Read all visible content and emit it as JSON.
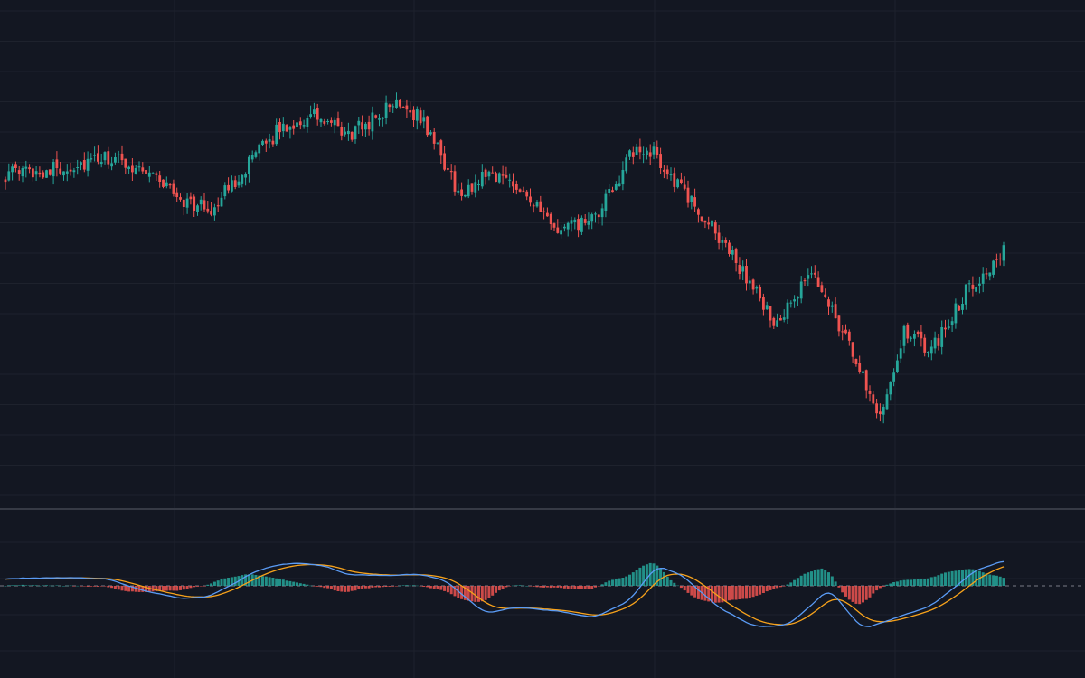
{
  "colors": {
    "background": "#131722",
    "grid": "#1e222d",
    "separator": "#363a45",
    "up": "#26a69a",
    "down": "#ef5350",
    "macd_line": "#5b9cf6",
    "signal_line": "#f7a21b",
    "zero_line": "#787b86"
  },
  "chart_data": [
    {
      "type": "candlestick",
      "panel": "price",
      "grid": true,
      "x": {
        "count": 292
      },
      "y": {
        "range": [
          0,
          100
        ]
      },
      "trend_anchors": [
        [
          0,
          80
        ],
        [
          18,
          82
        ],
        [
          30,
          84.5
        ],
        [
          42,
          81
        ],
        [
          52,
          72.5
        ],
        [
          60,
          70
        ],
        [
          70,
          82
        ],
        [
          80,
          93
        ],
        [
          90,
          96.5
        ],
        [
          100,
          91
        ],
        [
          115,
          101
        ],
        [
          122,
          95
        ],
        [
          133,
          73
        ],
        [
          140,
          81
        ],
        [
          150,
          77
        ],
        [
          160,
          64
        ],
        [
          172,
          67
        ],
        [
          182,
          85
        ],
        [
          188,
          87
        ],
        [
          200,
          72
        ],
        [
          210,
          60
        ],
        [
          225,
          37
        ],
        [
          235,
          52
        ],
        [
          240,
          44
        ],
        [
          255,
          12
        ],
        [
          262,
          35
        ],
        [
          270,
          30
        ],
        [
          280,
          47
        ],
        [
          291,
          58
        ]
      ],
      "wick_extremes": {
        "max_high": 103.5,
        "min_low": 0
      }
    },
    {
      "type": "macd",
      "panel": "indicator",
      "grid": true,
      "x": {
        "count": 292
      },
      "y": {
        "range": [
          -100,
          40
        ]
      },
      "zero_line": true,
      "series": [
        {
          "key": "macd",
          "kind": "line"
        },
        {
          "key": "signal",
          "kind": "line"
        },
        {
          "key": "histogram",
          "kind": "bar"
        }
      ],
      "macd_anchors": [
        [
          0,
          10
        ],
        [
          15,
          11
        ],
        [
          30,
          9
        ],
        [
          40,
          -6
        ],
        [
          52,
          -18
        ],
        [
          60,
          -14
        ],
        [
          72,
          18
        ],
        [
          82,
          32
        ],
        [
          92,
          28
        ],
        [
          100,
          16
        ],
        [
          108,
          14
        ],
        [
          120,
          16
        ],
        [
          128,
          8
        ],
        [
          140,
          -38
        ],
        [
          150,
          -30
        ],
        [
          160,
          -34
        ],
        [
          172,
          -44
        ],
        [
          182,
          -20
        ],
        [
          190,
          28
        ],
        [
          198,
          12
        ],
        [
          208,
          -30
        ],
        [
          218,
          -56
        ],
        [
          228,
          -55
        ],
        [
          240,
          -5
        ],
        [
          250,
          -60
        ],
        [
          260,
          -44
        ],
        [
          270,
          -28
        ],
        [
          282,
          18
        ],
        [
          291,
          36
        ]
      ]
    }
  ]
}
